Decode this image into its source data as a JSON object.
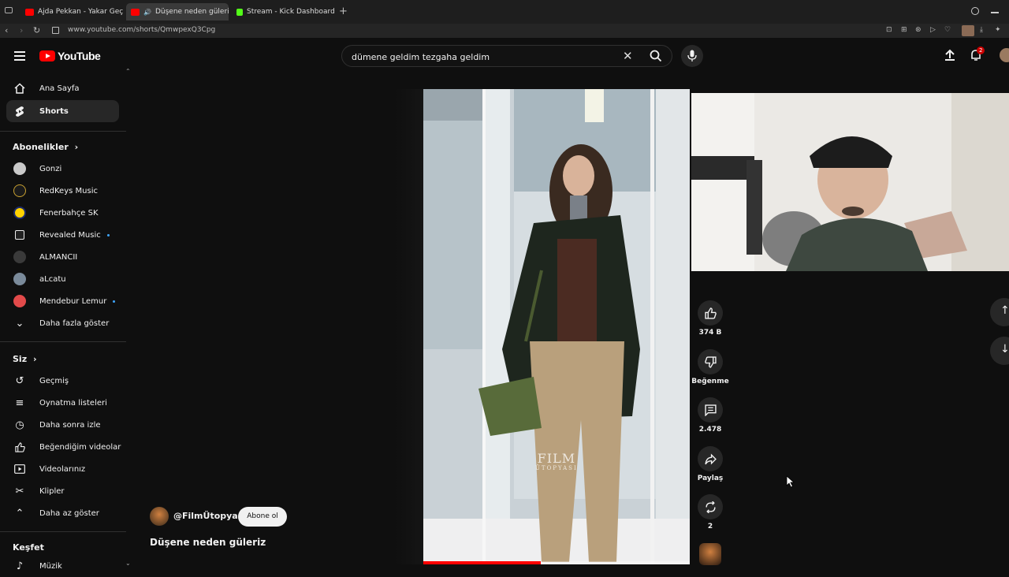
{
  "browser": {
    "tabs": [
      {
        "title": "Ajda Pekkan - Yakar Geçe",
        "active": false
      },
      {
        "title": "Düşene neden güleriz",
        "active": true
      },
      {
        "title": "Stream - Kick Dashboard",
        "active": false
      }
    ],
    "url": "www.youtube.com/shorts/QmwpexQ3Cpg",
    "new_tab": "+"
  },
  "header": {
    "logo": "YouTube",
    "search_value": "dümene geldim tezgaha geldim",
    "notification_count": "2"
  },
  "sidebar": {
    "main": [
      {
        "label": "Ana Sayfa",
        "icon": "home-icon"
      },
      {
        "label": "Shorts",
        "icon": "shorts-icon",
        "active": true
      }
    ],
    "subscriptions_title": "Abonelikler",
    "subscriptions": [
      {
        "label": "Gonzi",
        "color": "#c9c9c9",
        "dot": false
      },
      {
        "label": "RedKeys Music",
        "color": "#1a1a1a",
        "dot": false
      },
      {
        "label": "Fenerbahçe SK",
        "color": "#ffd200",
        "dot": false
      },
      {
        "label": "Revealed Music",
        "color": "#222222",
        "dot": true
      },
      {
        "label": "ALMANCII",
        "color": "#3a3a3a",
        "dot": false
      },
      {
        "label": "aLcatu",
        "color": "#7a8a9a",
        "dot": false
      },
      {
        "label": "Mendebur Lemur",
        "color": "#e24a4a",
        "dot": true
      }
    ],
    "show_more": "Daha fazla göster",
    "you_title": "Siz",
    "you": [
      {
        "label": "Geçmiş",
        "icon": "history-icon"
      },
      {
        "label": "Oynatma listeleri",
        "icon": "playlists-icon"
      },
      {
        "label": "Daha sonra izle",
        "icon": "watch-later-icon"
      },
      {
        "label": "Beğendiğim videolar",
        "icon": "liked-icon"
      },
      {
        "label": "Videolarınız",
        "icon": "your-videos-icon"
      },
      {
        "label": "Klipler",
        "icon": "clips-icon"
      }
    ],
    "show_less": "Daha az göster",
    "explore_title": "Keşfet",
    "explore_first": "Müzik"
  },
  "short": {
    "channel": "@FilmÜtopyası",
    "subscribe": "Abone ol",
    "title": "Düşene neden güleriz",
    "watermark_line1": "FILM",
    "watermark_line2": "ÜTOPYASI",
    "progress": 0.44
  },
  "actions": {
    "likes": "374 B",
    "dislike": "Beğenme",
    "comments": "2.478",
    "share": "Paylaş",
    "remix": "2"
  },
  "colors": {
    "accent": "#ff0000",
    "background": "#0f0f0f"
  }
}
